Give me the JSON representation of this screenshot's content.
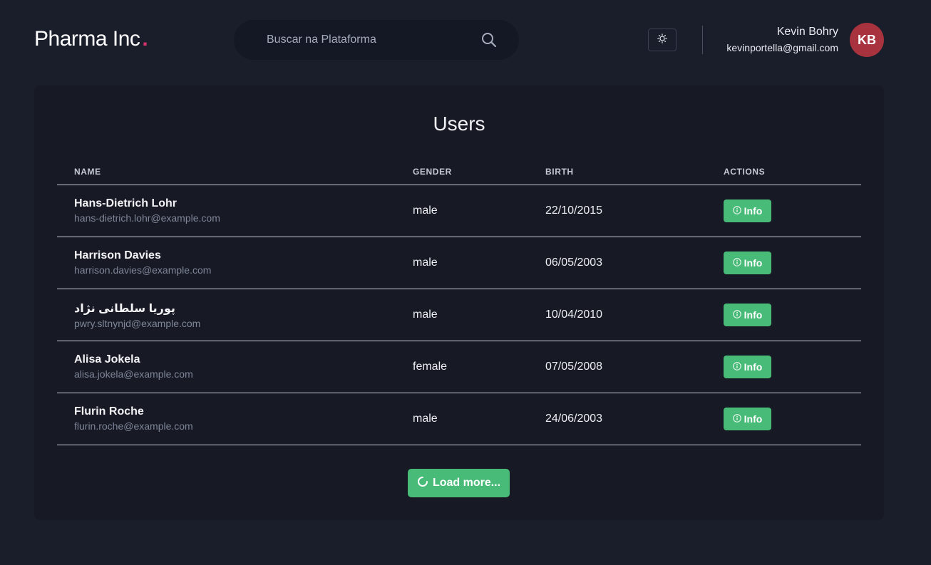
{
  "header": {
    "logo_text": "Pharma Inc",
    "logo_dot": ".",
    "search_placeholder": "Buscar na Plataforma",
    "search_icon": "search-icon",
    "theme_toggle_icon": "sun-icon",
    "user": {
      "name": "Kevin Bohry",
      "email": "kevinportella@gmail.com",
      "initials": "KB",
      "avatar_color": "#a8323e"
    }
  },
  "main": {
    "title": "Users",
    "columns": [
      "NAME",
      "GENDER",
      "BIRTH",
      "ACTIONS"
    ],
    "rows": [
      {
        "name": "Hans-Dietrich Lohr",
        "email": "hans-dietrich.lohr@example.com",
        "gender": "male",
        "birth": "22/10/2015",
        "action": "Info"
      },
      {
        "name": "Harrison Davies",
        "email": "harrison.davies@example.com",
        "gender": "male",
        "birth": "06/05/2003",
        "action": "Info"
      },
      {
        "name": "پوریا سلطانی نژاد",
        "email": "pwry.sltnynjd@example.com",
        "gender": "male",
        "birth": "10/04/2010",
        "action": "Info"
      },
      {
        "name": "Alisa Jokela",
        "email": "alisa.jokela@example.com",
        "gender": "female",
        "birth": "07/05/2008",
        "action": "Info"
      },
      {
        "name": "Flurin Roche",
        "email": "flurin.roche@example.com",
        "gender": "male",
        "birth": "24/06/2003",
        "action": "Info"
      }
    ],
    "load_more_label": "Load more...",
    "accent_color": "#48bb78"
  }
}
